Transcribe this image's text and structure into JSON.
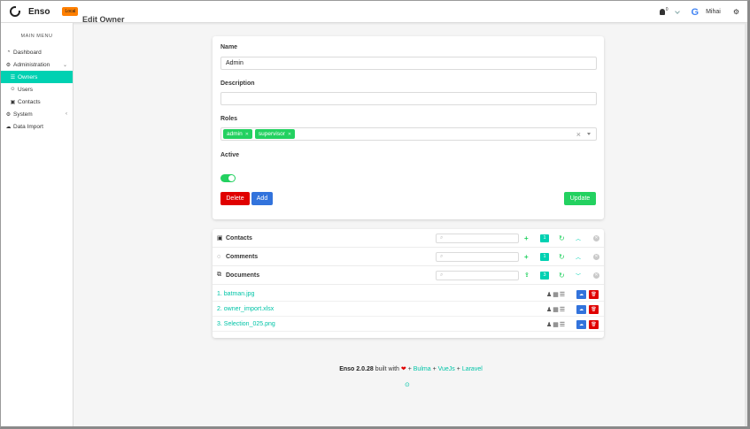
{
  "navbar": {
    "brand": "Enso",
    "env_tag": "Local",
    "notification_count": "0",
    "user_name": "Mihai",
    "google_letter": "G"
  },
  "sidebar": {
    "menu_label": "MAIN MENU",
    "items": [
      {
        "label": "Dashboard",
        "icon": "tachometer-icon",
        "glyph": "◔"
      },
      {
        "label": "Administration",
        "icon": "users-cog-icon",
        "glyph": "⚙"
      },
      {
        "label": "Owners",
        "icon": "list-icon",
        "glyph": "☰"
      },
      {
        "label": "Users",
        "icon": "users-icon",
        "glyph": "☺"
      },
      {
        "label": "Contacts",
        "icon": "address-card-icon",
        "glyph": "▣"
      },
      {
        "label": "System",
        "icon": "cogs-icon",
        "glyph": "⚙"
      },
      {
        "label": "Data Import",
        "icon": "cloud-upload-icon",
        "glyph": "☁"
      }
    ]
  },
  "page": {
    "title": "Edit Owner"
  },
  "form": {
    "name_label": "Name",
    "name_value": "Admin",
    "description_label": "Description",
    "description_value": "",
    "roles_label": "Roles",
    "roles": [
      "admin",
      "supervisor"
    ],
    "active_label": "Active",
    "active": true,
    "delete_label": "Delete",
    "add_label": "Add",
    "update_label": "Update"
  },
  "accessories": [
    {
      "title": "Contacts",
      "count": "1"
    },
    {
      "title": "Comments",
      "count": "1"
    },
    {
      "title": "Documents",
      "count": "3"
    }
  ],
  "documents": [
    "1. batman.jpg",
    "2. owner_import.xlsx",
    "3. Selection_025.png"
  ],
  "footer": {
    "version": "Enso 2.0.28",
    "built_with": "built with",
    "plus1": "+",
    "bulma": "Bulma",
    "plus2": "+",
    "vuejs": "VueJs",
    "plus3": "+",
    "laravel": "Laravel"
  },
  "colors": {
    "accent": "#00d1b2",
    "success": "#23d160",
    "danger": "#e00000",
    "info": "#3273dc",
    "warning": "#ff7f00"
  }
}
